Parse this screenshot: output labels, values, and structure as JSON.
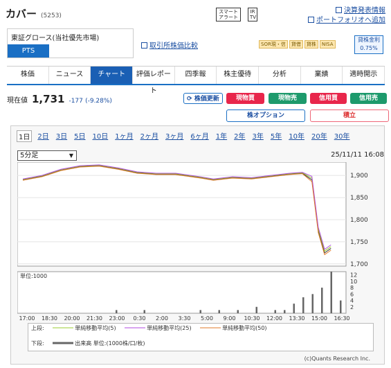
{
  "company": {
    "name": "カバー",
    "code": "(5253)"
  },
  "top_buttons": {
    "smart_alert": "スマート アラート",
    "ir_tv": "IR TV"
  },
  "top_links": {
    "earnings": "決算発表情報",
    "portfolio": "ポートフォリオへ追加"
  },
  "market": {
    "label": "東証グロース(当社優先市場)",
    "pts": "PTS"
  },
  "compare_link": "取引所株価比較",
  "tags": [
    "SOR現・信",
    "貸借",
    "貸株",
    "NISA"
  ],
  "min_amount": {
    "label": "貸株金利",
    "value": "0.75%"
  },
  "tabs": [
    "株価",
    "ニュース",
    "チャート",
    "評価レポート",
    "四季報",
    "株主優待",
    "分析",
    "業績",
    "適時開示"
  ],
  "active_tab": "チャート",
  "price": {
    "label": "現在値",
    "value": "1,731",
    "change": "-177",
    "pct": "(-9.28%)"
  },
  "actions": {
    "refresh": "株価更新",
    "buy": "現物買",
    "sell": "現物売",
    "margin_buy": "信用買",
    "margin_sell": "信用売",
    "option": "株オプション",
    "savings": "積立"
  },
  "periods": [
    "1日",
    "2日",
    "3日",
    "5日",
    "10日",
    "1ヶ月",
    "2ヶ月",
    "3ヶ月",
    "6ヶ月",
    "1年",
    "2年",
    "3年",
    "5年",
    "10年",
    "20年",
    "30年"
  ],
  "selected_period": "1日",
  "interval": "5分足",
  "datetime": "25/11/11 16:08",
  "chart_data": {
    "type": "line",
    "x_ticks": [
      "17:00",
      "18:30",
      "20:00",
      "21:30",
      "23:00",
      "0:30",
      "2:00",
      "3:30",
      "5:00",
      "9:00",
      "10:30",
      "12:00",
      "13:30",
      "15:00",
      "16:30"
    ],
    "y_ticks": [
      "1,900",
      "1,850",
      "1,800",
      "1,750",
      "1,700"
    ],
    "ylim": [
      1695,
      1930
    ],
    "volume_unit_label": "単位:1000",
    "volume_ticks": [
      "12",
      "10",
      "8",
      "6",
      "4",
      "2"
    ],
    "price_series": [
      {
        "t": 0,
        "v": 1890
      },
      {
        "t": 0.06,
        "v": 1898
      },
      {
        "t": 0.12,
        "v": 1912
      },
      {
        "t": 0.18,
        "v": 1920
      },
      {
        "t": 0.24,
        "v": 1922
      },
      {
        "t": 0.3,
        "v": 1915
      },
      {
        "t": 0.36,
        "v": 1906
      },
      {
        "t": 0.42,
        "v": 1903
      },
      {
        "t": 0.48,
        "v": 1903
      },
      {
        "t": 0.56,
        "v": 1895
      },
      {
        "t": 0.6,
        "v": 1890
      },
      {
        "t": 0.66,
        "v": 1895
      },
      {
        "t": 0.72,
        "v": 1893
      },
      {
        "t": 0.78,
        "v": 1898
      },
      {
        "t": 0.84,
        "v": 1903
      },
      {
        "t": 0.88,
        "v": 1905
      },
      {
        "t": 0.91,
        "v": 1890
      },
      {
        "t": 0.93,
        "v": 1775
      },
      {
        "t": 0.95,
        "v": 1725
      },
      {
        "t": 0.97,
        "v": 1735
      }
    ],
    "ma_series": [
      {
        "name": "単純移動平均(5)",
        "color": "#9acd32"
      },
      {
        "name": "単純移動平均(25)",
        "color": "#b04ae0"
      },
      {
        "name": "単純移動平均(50)",
        "color": "#e07a2a"
      }
    ],
    "legend_upper": "上段:",
    "legend_lower": "下段:",
    "volume_legend": "出来高 単位:(1000株/口/枚)",
    "volumes": [
      0,
      0,
      0,
      0,
      0,
      0,
      0,
      0,
      0,
      0,
      1,
      0,
      0,
      1,
      0,
      0,
      0,
      0,
      0,
      1,
      0,
      1,
      0,
      1,
      0,
      2,
      0,
      1,
      1,
      3,
      5,
      6,
      8,
      13,
      4
    ]
  },
  "copyright": "(c)Quants Research Inc."
}
